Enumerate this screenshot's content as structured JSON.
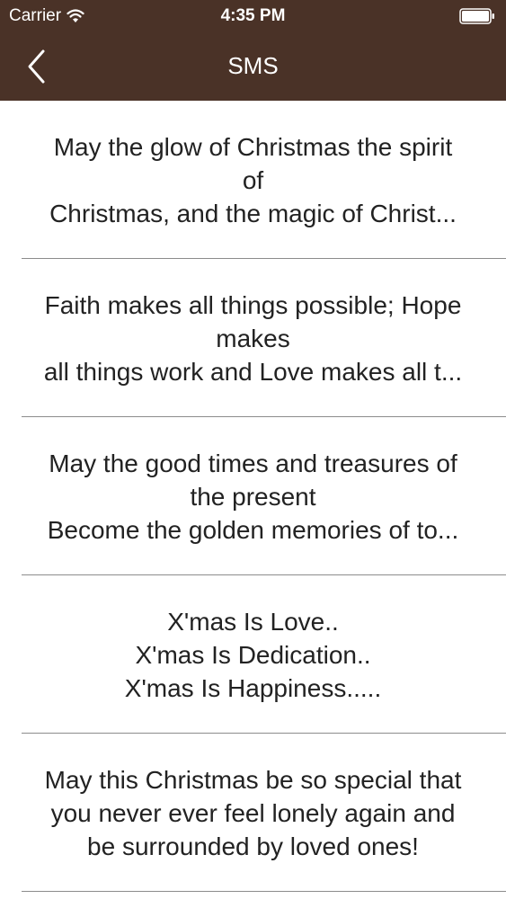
{
  "status_bar": {
    "carrier": "Carrier",
    "time": "4:35 PM"
  },
  "nav": {
    "title": "SMS"
  },
  "items": [
    {
      "text": "May the glow of Christmas the spirit\nof\nChristmas, and the magic of Christ..."
    },
    {
      "text": "Faith makes all things possible; Hope\nmakes\nall things work and Love makes all t..."
    },
    {
      "text": "May the good times and treasures of\nthe present\nBecome the golden memories of to..."
    },
    {
      "text": "X'mas Is Love..\nX'mas Is Dedication..\nX'mas Is Happiness....."
    },
    {
      "text": "May this Christmas be so special that\nyou never ever feel lonely again and\nbe surrounded by loved ones!"
    }
  ],
  "colors": {
    "topbar": "#4a3227",
    "separator": "#8c8c8c",
    "text": "#222222"
  }
}
